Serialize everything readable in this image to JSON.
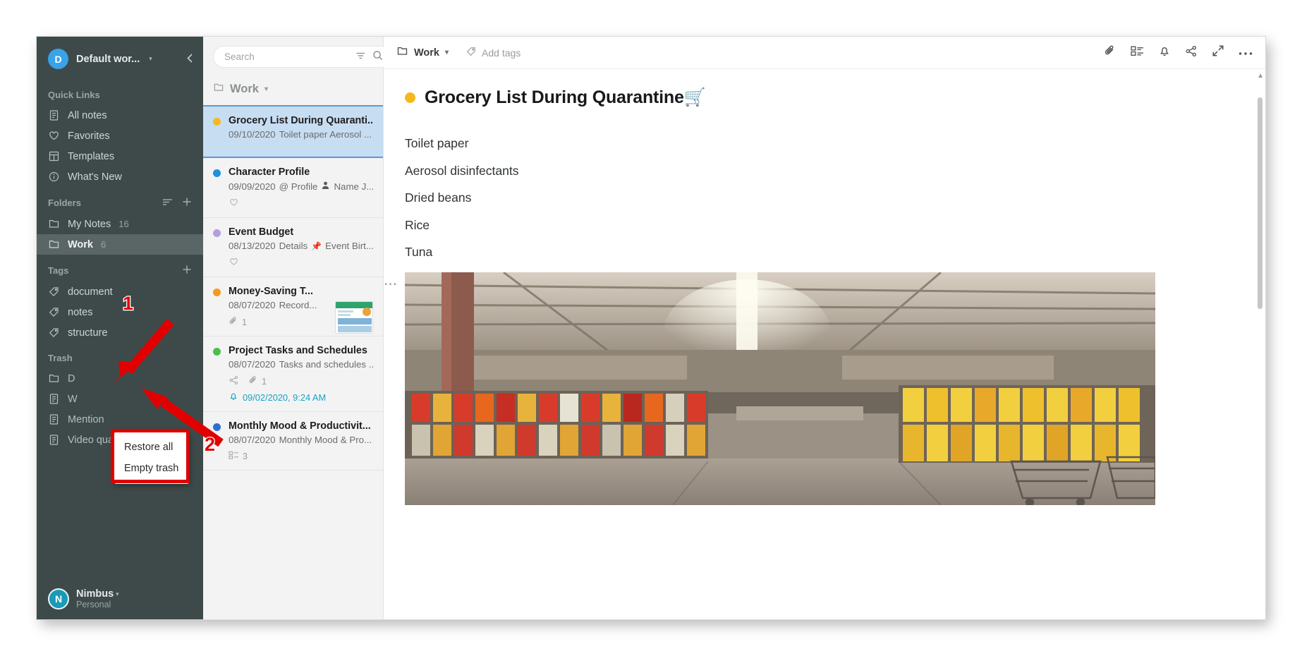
{
  "sidebar": {
    "workspace": {
      "avatar_letter": "D",
      "name": "Default wor...",
      "caret": "▾"
    },
    "quick_links_label": "Quick Links",
    "quick_links": [
      {
        "icon": "note-icon",
        "label": "All notes"
      },
      {
        "icon": "heart-icon",
        "label": "Favorites"
      },
      {
        "icon": "templates-icon",
        "label": "Templates"
      },
      {
        "icon": "info-icon",
        "label": "What's New"
      }
    ],
    "folders_label": "Folders",
    "folders": [
      {
        "icon": "folder-icon",
        "label": "My Notes",
        "count": "16",
        "selected": false
      },
      {
        "icon": "folder-icon",
        "label": "Work",
        "count": "6",
        "selected": true
      }
    ],
    "tags_label": "Tags",
    "tags": [
      {
        "icon": "tag-icon",
        "label": "document"
      },
      {
        "icon": "tag-icon",
        "label": "notes"
      },
      {
        "icon": "tag-icon",
        "label": "structure"
      }
    ],
    "trash_label": "Trash",
    "trash_items": [
      {
        "icon": "folder-icon",
        "label": "D"
      },
      {
        "icon": "note-icon",
        "label": "W"
      },
      {
        "icon": "note-icon",
        "label": "Mention"
      },
      {
        "icon": "note-icon",
        "label": "Video quality"
      }
    ],
    "user": {
      "avatar_letter": "N",
      "name": "Nimbus",
      "plan": "Personal",
      "caret": "▾"
    }
  },
  "context_menu": {
    "items": [
      {
        "label": "Restore all"
      },
      {
        "label": "Empty trash"
      }
    ],
    "highlight_color": "#e00000"
  },
  "annotations": [
    {
      "number": "1",
      "target": "trash-section"
    },
    {
      "number": "2",
      "target": "context-menu"
    }
  ],
  "notelist": {
    "search": {
      "placeholder": "Search",
      "value": ""
    },
    "filter_icon": "filter-icon",
    "search_icon": "search-icon",
    "add_button_label": "+",
    "header": {
      "icon": "folder-icon",
      "label": "Work",
      "caret": "▾"
    },
    "notes": [
      {
        "color": "#f5b91f",
        "title": "Grocery List During Quaranti...",
        "date": "09/10/2020",
        "snippet": "Toilet paper Aerosol ...",
        "active": true,
        "meta": []
      },
      {
        "color": "#1e90e0",
        "title": "Character Profile",
        "date": "09/09/2020",
        "snippet": "@ Profile",
        "snippet_extra": "Name J...",
        "snippet_icon": "person-icon",
        "active": false,
        "meta": [
          {
            "icon": "heart-icon",
            "value": ""
          }
        ]
      },
      {
        "color": "#b49de0",
        "title": "Event Budget",
        "date": "08/13/2020",
        "snippet": "Details",
        "snippet_extra": "Event Birt...",
        "snippet_icon": "pin-icon",
        "active": false,
        "meta": [
          {
            "icon": "heart-icon",
            "value": ""
          }
        ]
      },
      {
        "color": "#f59a1f",
        "title": "Money-Saving T...",
        "date": "08/07/2020",
        "snippet": "Record...",
        "active": false,
        "has_thumbnail": true,
        "meta": [
          {
            "icon": "attachment-icon",
            "value": "1"
          }
        ]
      },
      {
        "color": "#4bbf4b",
        "title": "Project Tasks and Schedules",
        "date": "08/07/2020",
        "snippet": "Tasks and schedules ...",
        "active": false,
        "meta": [
          {
            "icon": "share-icon",
            "value": ""
          },
          {
            "icon": "attachment-icon",
            "value": "1"
          }
        ],
        "reminder": {
          "icon": "bell-icon",
          "text": "09/02/2020, 9:24 AM",
          "color": "#17a2c4"
        }
      },
      {
        "color": "#2f6fd0",
        "title": "Monthly Mood & Productivit...",
        "date": "08/07/2020",
        "snippet": "Monthly Mood & Pro...",
        "active": false,
        "meta": [
          {
            "icon": "table-icon",
            "value": "3"
          }
        ]
      }
    ]
  },
  "editor": {
    "breadcrumb": {
      "icon": "folder-icon",
      "label": "Work",
      "caret": "▾"
    },
    "add_tags": {
      "icon": "tag-icon",
      "label": "Add tags"
    },
    "tools": [
      {
        "icon": "attachment-icon",
        "name": "attachments-button"
      },
      {
        "icon": "grid-icon",
        "name": "widgets-button"
      },
      {
        "icon": "bell-icon",
        "name": "reminder-button"
      },
      {
        "icon": "share-icon",
        "name": "share-button"
      },
      {
        "icon": "expand-icon",
        "name": "fullscreen-button"
      },
      {
        "icon": "more-icon",
        "name": "more-options-button"
      }
    ],
    "doc": {
      "dot_color": "#f5b91f",
      "title": "Grocery List During Quarantine🛒",
      "lines": [
        "Toilet paper",
        "Aerosol disinfectants",
        "Dried beans",
        "Rice",
        "Tuna"
      ],
      "image_block_handle": "⋯"
    }
  }
}
